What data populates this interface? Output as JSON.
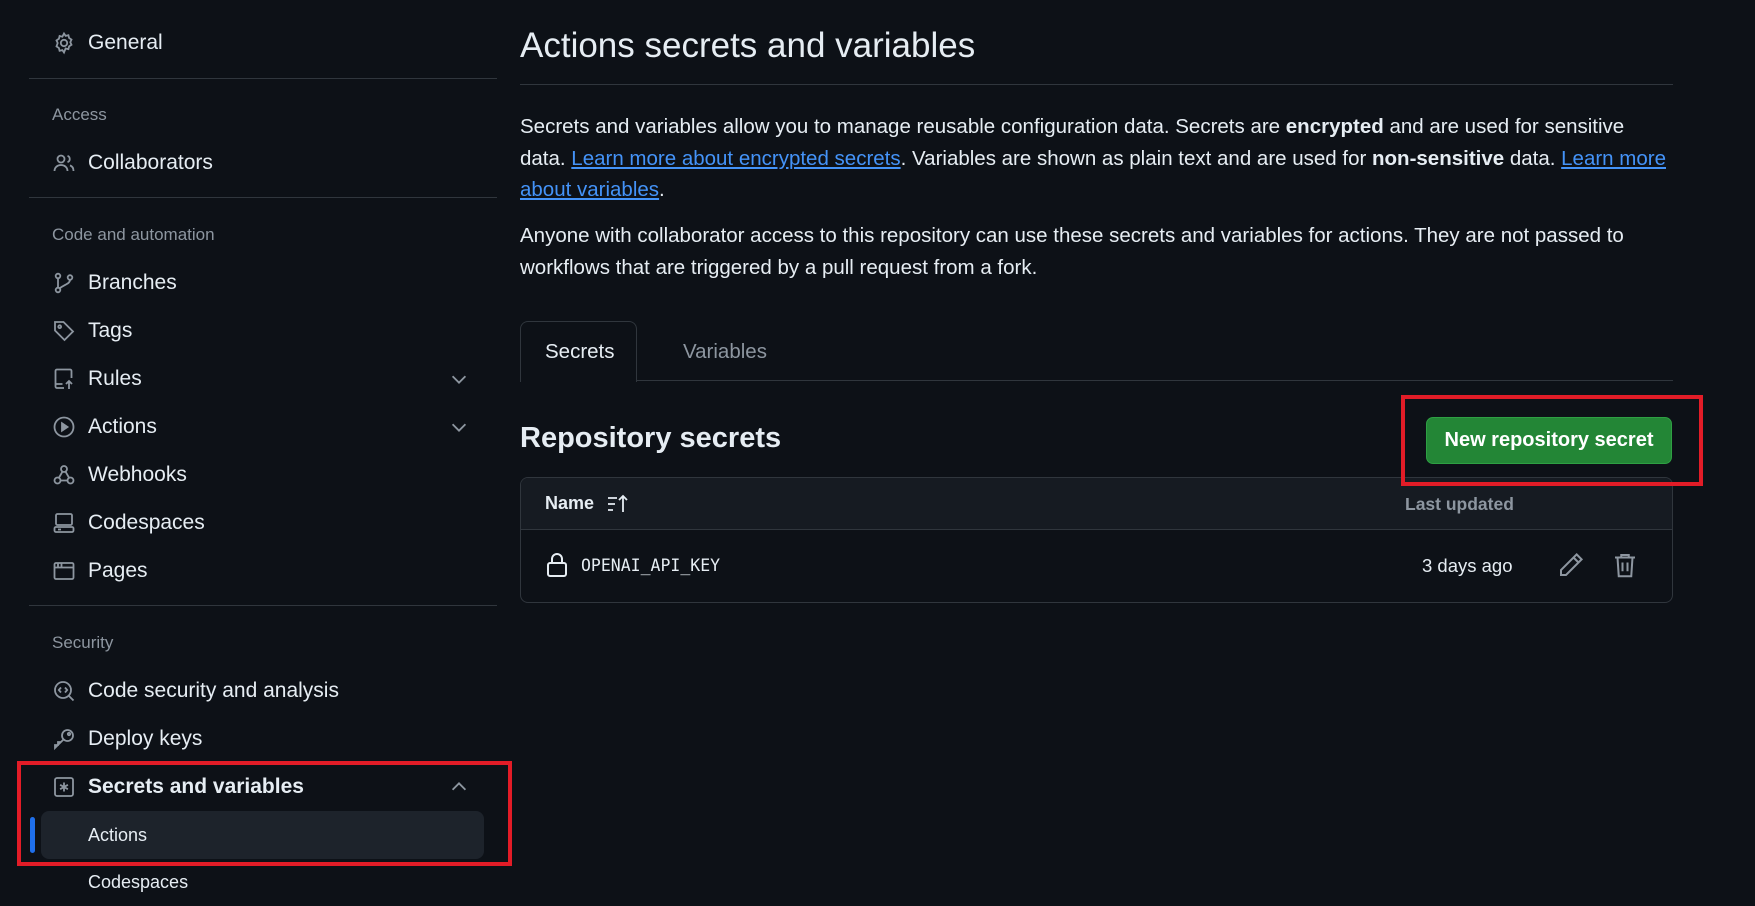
{
  "sidebar": {
    "general": "General",
    "access_heading": "Access",
    "collaborators": "Collaborators",
    "code_heading": "Code and automation",
    "branches": "Branches",
    "tags": "Tags",
    "rules": "Rules",
    "actions": "Actions",
    "webhooks": "Webhooks",
    "codespaces": "Codespaces",
    "pages": "Pages",
    "security_heading": "Security",
    "code_security": "Code security and analysis",
    "deploy_keys": "Deploy keys",
    "secrets_and_variables": "Secrets and variables",
    "sub_actions": "Actions",
    "sub_codespaces": "Codespaces"
  },
  "main": {
    "title": "Actions secrets and variables",
    "desc1": {
      "part1": "Secrets and variables allow you to manage reusable configuration data. Secrets are ",
      "bold1": "encrypted",
      "part2": " and are used for sensitive data. ",
      "link1": "Learn more about encrypted secrets",
      "part3": ". Variables are shown as plain text and are used for ",
      "bold2": "non-sensitive",
      "part4": " data. ",
      "link2": "Learn more about variables",
      "part5": "."
    },
    "desc2": "Anyone with collaborator access to this repository can use these secrets and variables for actions. They are not passed to workflows that are triggered by a pull request from a fork.",
    "tabs": [
      {
        "label": "Secrets",
        "selected": true
      },
      {
        "label": "Variables",
        "selected": false
      }
    ],
    "repo_heading": "Repository secrets",
    "new_secret_button": "New repository secret",
    "table": {
      "col_name": "Name",
      "col_updated": "Last updated",
      "rows": [
        {
          "name": "OPENAI_API_KEY",
          "updated": "3 days ago"
        }
      ]
    }
  },
  "colors": {
    "background": "#0d1117",
    "link": "#4493f8",
    "primary_button": "#238636",
    "highlight_box": "#e21c27",
    "active_indicator": "#1f6feb"
  }
}
